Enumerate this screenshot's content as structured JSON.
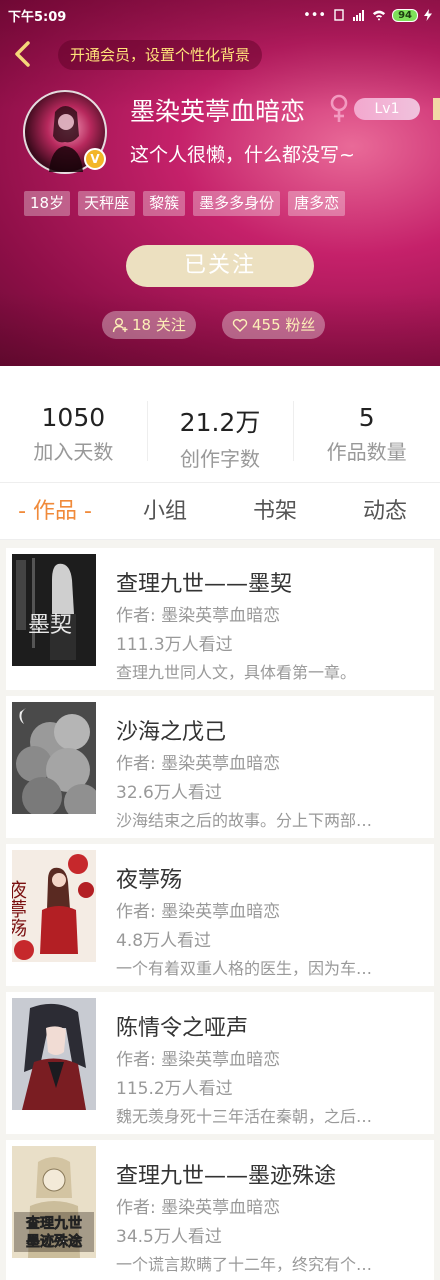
{
  "status_bar": {
    "time": "下午5:09",
    "battery": "94"
  },
  "header": {
    "vip_banner": "开通会员，设置个性化背景",
    "username": "墨染英葶血暗恋",
    "gender_symbol": "♀",
    "level": "Lv1",
    "bio": "这个人很懒，什么都没写~",
    "avatar_badge": "V",
    "tags": [
      "18岁",
      "天秤座",
      "黎簇",
      "墨多多身份",
      "唐多恋"
    ],
    "follow_button": "已关注",
    "following": "18 关注",
    "fans": "455 粉丝"
  },
  "stats": [
    {
      "value": "1050",
      "label": "加入天数"
    },
    {
      "value": "21.2万",
      "label": "创作字数"
    },
    {
      "value": "5",
      "label": "作品数量"
    }
  ],
  "tabs": [
    "- 作品 -",
    "小组",
    "书架",
    "动态"
  ],
  "books": [
    {
      "title": "查理九世——墨契",
      "author": "作者: 墨染英葶血暗恋",
      "views": "111.3万人看过",
      "desc": "查理九世同人文，具体看第一章。"
    },
    {
      "title": "沙海之戊己",
      "author": "作者: 墨染英葶血暗恋",
      "views": "32.6万人看过",
      "desc": "沙海结束之后的故事。分上下两部…"
    },
    {
      "title": "夜葶殇",
      "author": "作者: 墨染英葶血暗恋",
      "views": "4.8万人看过",
      "desc": "一个有着双重人格的医生，因为车…"
    },
    {
      "title": "陈情令之哑声",
      "author": "作者: 墨染英葶血暗恋",
      "views": "115.2万人看过",
      "desc": "魏无羡身死十三年活在秦朝，之后…"
    },
    {
      "title": "查理九世——墨迹殊途",
      "author": "作者: 墨染英葶血暗恋",
      "views": "34.5万人看过",
      "desc": "一个谎言欺瞒了十二年，终究有个…"
    }
  ],
  "cover_texts": {
    "book1": "墨契",
    "book3": "夜葶殇",
    "book5_line1": "查理九世",
    "book5_line2": "墨迹殊途"
  },
  "colors": {
    "accent": "#f08a3a",
    "header": "#c5216a",
    "vip_text": "#ffe27a",
    "follow_button": "#ece0c0"
  }
}
